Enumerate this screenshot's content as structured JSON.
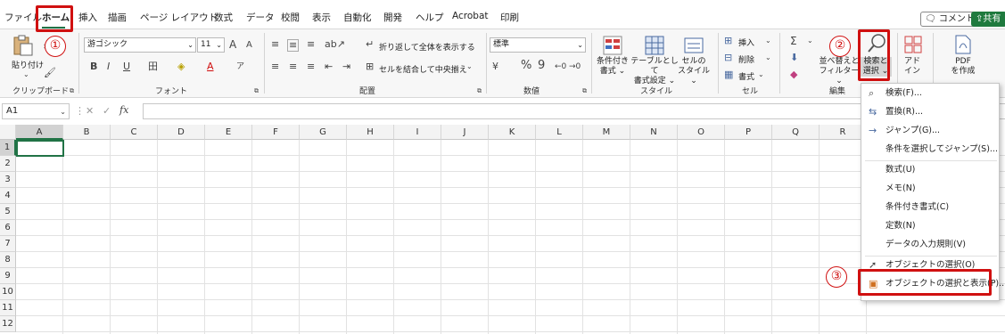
{
  "tabs": [
    "ファイル",
    "ホーム",
    "挿入",
    "描画",
    "ページ レイアウト",
    "数式",
    "データ",
    "校閲",
    "表示",
    "自動化",
    "開発",
    "ヘルプ",
    "Acrobat",
    "印刷"
  ],
  "top_right": {
    "comment": "コメント",
    "share": "共有"
  },
  "callouts": [
    "①",
    "②",
    "③"
  ],
  "ribbon": {
    "clipboard": {
      "paste": "貼り付け",
      "label": "クリップボード"
    },
    "font": {
      "name": "游ゴシック",
      "size": "11",
      "grow": "A",
      "shrink": "A",
      "bold": "B",
      "italic": "I",
      "underline": "U",
      "font_color": "A",
      "label": "フォント"
    },
    "alignment": {
      "wrap": "折り返して全体を表示する",
      "merge": "セルを結合して中央揃え",
      "label": "配置"
    },
    "number": {
      "format": "標準",
      "percent": "%",
      "comma": "9",
      "label": "数値"
    },
    "styles": {
      "conditional": [
        "条件付き",
        "書式"
      ],
      "table": [
        "テーブルとして",
        "書式設定"
      ],
      "cell": [
        "セルの",
        "スタイル"
      ],
      "label": "スタイル"
    },
    "cells": {
      "insert": "挿入",
      "delete": "削除",
      "format": "書式",
      "label": "セル"
    },
    "editing": {
      "sigma": "Σ",
      "sort": [
        "並べ替えと",
        "フィルター"
      ],
      "find": [
        "検索と",
        "選択"
      ],
      "label": "編集"
    },
    "addins": [
      "アド",
      "イン"
    ],
    "pdf": [
      "PDF",
      "を作成"
    ]
  },
  "formula_bar": {
    "name_box": "A1",
    "fx": "fx",
    "value": ""
  },
  "columns": [
    "A",
    "B",
    "C",
    "D",
    "E",
    "F",
    "G",
    "H",
    "I",
    "J",
    "K",
    "L",
    "M",
    "N",
    "O",
    "P",
    "Q",
    "R"
  ],
  "rows": [
    "1",
    "2",
    "3",
    "4",
    "5",
    "6",
    "7",
    "8",
    "9",
    "10",
    "11",
    "12"
  ],
  "menu": [
    {
      "label": "検索(F)...",
      "icon": "search-icon"
    },
    {
      "label": "置換(R)...",
      "icon": "replace-icon"
    },
    {
      "label": "ジャンプ(G)...",
      "icon": "arrow-right-icon"
    },
    {
      "label": "条件を選択してジャンプ(S)...",
      "icon": ""
    },
    {
      "label": "数式(U)",
      "icon": ""
    },
    {
      "label": "メモ(N)",
      "icon": ""
    },
    {
      "label": "条件付き書式(C)",
      "icon": ""
    },
    {
      "label": "定数(N)",
      "icon": ""
    },
    {
      "label": "データの入力規則(V)",
      "icon": ""
    },
    {
      "label": "オブジェクトの選択(O)",
      "icon": "pointer-icon"
    },
    {
      "label": "オブジェクトの選択と表示(P)...",
      "icon": "selection-pane-icon"
    }
  ],
  "colors": {
    "accent": "#217346",
    "highlight": "#d01010"
  }
}
